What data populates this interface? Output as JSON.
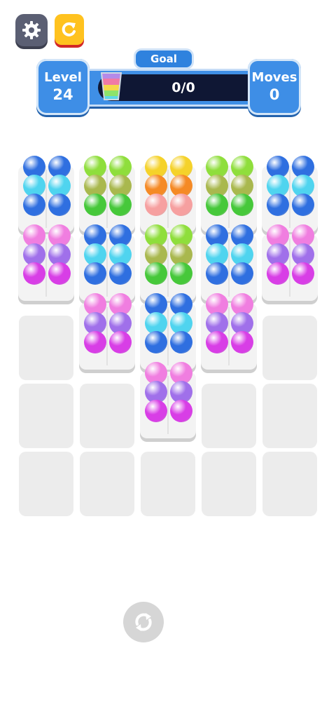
{
  "hud": {
    "level_label": "Level",
    "level_value": "24",
    "goal_label": "Goal",
    "goal_progress": "0/0",
    "moves_label": "Moves",
    "moves_value": "0"
  },
  "buttons": {
    "settings_icon": "gear-icon",
    "restart_icon": "restart-icon",
    "shuffle_icon": "shuffle-icon"
  },
  "colors": {
    "blue": "#2f6fe0",
    "cyan": "#4fd4ef",
    "green": "#46c83a",
    "lime": "#8fde3c",
    "olive": "#a9b84e",
    "yellow": "#f5d22a",
    "orange": "#f58a25",
    "peach": "#f6a0a0",
    "pink": "#f07ee0",
    "violet": "#a070ea",
    "magenta": "#d83ee6"
  },
  "board": {
    "grid_columns": 5,
    "grid_rows": 5,
    "holders": [
      {
        "col": 0,
        "row": 0,
        "balls": [
          [
            "blue",
            "blue"
          ],
          [
            "cyan",
            "cyan"
          ],
          [
            "blue",
            "blue"
          ]
        ]
      },
      {
        "col": 0,
        "row": 1,
        "balls": [
          [
            "pink",
            "pink"
          ],
          [
            "violet",
            "violet"
          ],
          [
            "magenta",
            "magenta"
          ]
        ]
      },
      {
        "col": 1,
        "row": 0,
        "balls": [
          [
            "lime",
            "lime"
          ],
          [
            "olive",
            "olive"
          ],
          [
            "green",
            "green"
          ]
        ]
      },
      {
        "col": 1,
        "row": 1,
        "balls": [
          [
            "blue",
            "blue"
          ],
          [
            "cyan",
            "cyan"
          ],
          [
            "blue",
            "blue"
          ]
        ]
      },
      {
        "col": 1,
        "row": 2,
        "balls": [
          [
            "pink",
            "pink"
          ],
          [
            "violet",
            "violet"
          ],
          [
            "magenta",
            "magenta"
          ]
        ]
      },
      {
        "col": 2,
        "row": 0,
        "balls": [
          [
            "yellow",
            "yellow"
          ],
          [
            "orange",
            "orange"
          ],
          [
            "peach",
            "peach"
          ]
        ]
      },
      {
        "col": 2,
        "row": 1,
        "balls": [
          [
            "lime",
            "lime"
          ],
          [
            "olive",
            "olive"
          ],
          [
            "green",
            "green"
          ]
        ]
      },
      {
        "col": 2,
        "row": 2,
        "balls": [
          [
            "blue",
            "blue"
          ],
          [
            "cyan",
            "cyan"
          ],
          [
            "blue",
            "blue"
          ]
        ]
      },
      {
        "col": 2,
        "row": 3,
        "balls": [
          [
            "pink",
            "pink"
          ],
          [
            "violet",
            "violet"
          ],
          [
            "magenta",
            "magenta"
          ]
        ]
      },
      {
        "col": 3,
        "row": 0,
        "balls": [
          [
            "lime",
            "lime"
          ],
          [
            "olive",
            "olive"
          ],
          [
            "green",
            "green"
          ]
        ]
      },
      {
        "col": 3,
        "row": 1,
        "balls": [
          [
            "blue",
            "blue"
          ],
          [
            "cyan",
            "cyan"
          ],
          [
            "blue",
            "blue"
          ]
        ]
      },
      {
        "col": 3,
        "row": 2,
        "balls": [
          [
            "pink",
            "pink"
          ],
          [
            "violet",
            "violet"
          ],
          [
            "magenta",
            "magenta"
          ]
        ]
      },
      {
        "col": 4,
        "row": 0,
        "balls": [
          [
            "blue",
            "blue"
          ],
          [
            "cyan",
            "cyan"
          ],
          [
            "blue",
            "blue"
          ]
        ]
      },
      {
        "col": 4,
        "row": 1,
        "balls": [
          [
            "pink",
            "pink"
          ],
          [
            "violet",
            "violet"
          ],
          [
            "magenta",
            "magenta"
          ]
        ]
      }
    ]
  }
}
